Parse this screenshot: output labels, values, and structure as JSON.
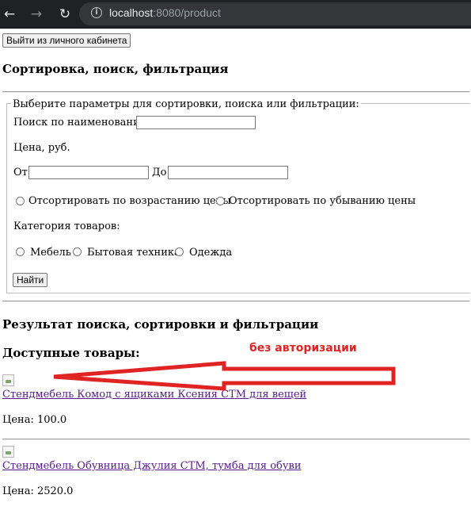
{
  "browser": {
    "url_host": "localhost",
    "url_rest": ":8080/product",
    "icons": [
      "back-arrow-icon",
      "forward-arrow-icon",
      "reload-icon",
      "info-icon"
    ]
  },
  "logout_button": "Выйти из личного кабинета",
  "section_title": "Сортировка, поиск, фильтрация",
  "form": {
    "legend": "Выберите параметры для сортировки, поиска или фильтрации:",
    "search_label": "Поиск по наименованию",
    "search_value": "",
    "price_label": "Цена, руб.",
    "from_label": "От",
    "to_label": "До",
    "from_value": "",
    "to_value": "",
    "sort_options": [
      "Отсортировать по возрастанию цены",
      "Отсортировать по убыванию цены"
    ],
    "category_label": "Категория товаров:",
    "categories": [
      "Мебель",
      "Бытовая техника",
      "Одежда"
    ],
    "submit_label": "Найти"
  },
  "results_title": "Результат поиска, сортировки и фильтрации",
  "available_title": "Доступные товары:",
  "annotation": {
    "text": "без авторизации",
    "color": "#e02424"
  },
  "products": [
    {
      "name": "Стендмебель Комод с ящиками Ксения СТМ для вещей",
      "price": "Цена: 100.0"
    },
    {
      "name": "Стендмебель Обувница Джулия СТМ, тумба для обуви",
      "price": "Цена: 2520.0"
    }
  ]
}
